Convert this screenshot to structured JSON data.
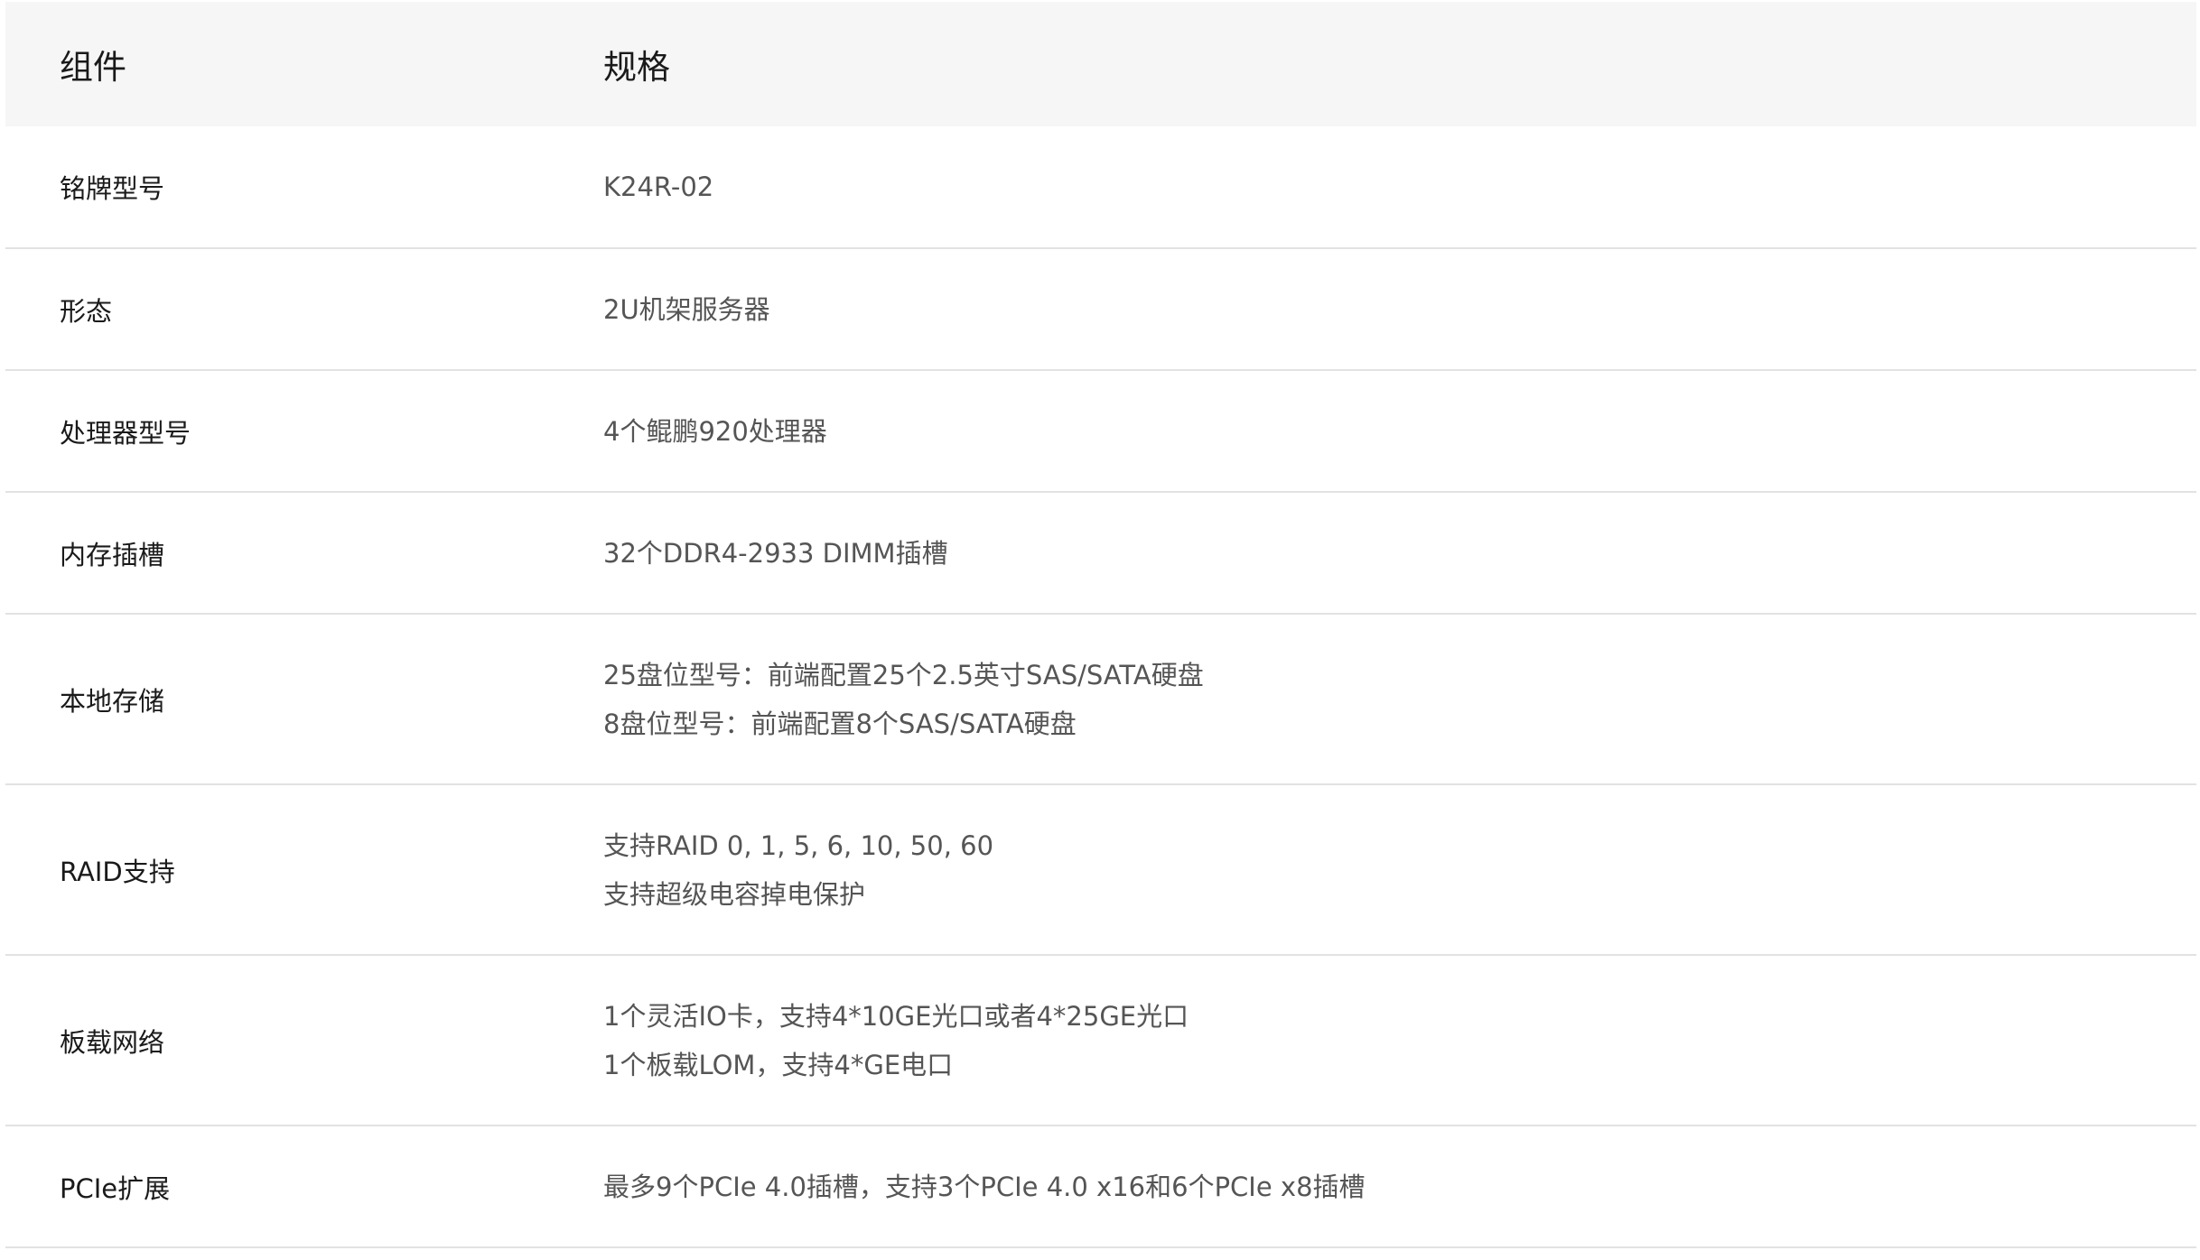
{
  "table": {
    "headers": [
      "组件",
      "规格"
    ],
    "rows": [
      {
        "name": "铭牌型号",
        "values": [
          "K24R-02"
        ]
      },
      {
        "name": "形态",
        "values": [
          "2U机架服务器"
        ]
      },
      {
        "name": "处理器型号",
        "values": [
          "4个鲲鹏920处理器"
        ]
      },
      {
        "name": "内存插槽",
        "values": [
          "32个DDR4-2933 DIMM插槽"
        ]
      },
      {
        "name": "本地存储",
        "values": [
          "25盘位型号：前端配置25个2.5英寸SAS/SATA硬盘",
          "8盘位型号：前端配置8个SAS/SATA硬盘"
        ]
      },
      {
        "name": "RAID支持",
        "values": [
          "支持RAID 0, 1, 5, 6, 10, 50, 60",
          "支持超级电容掉电保护"
        ]
      },
      {
        "name": "板载网络",
        "values": [
          "1个灵活IO卡，支持4*10GE光口或者4*25GE光口",
          "1个板载LOM，支持4*GE电口"
        ]
      },
      {
        "name": "PCIe扩展",
        "values": [
          "最多9个PCIe 4.0插槽，支持3个PCIe 4.0 x16和6个PCIe x8插槽"
        ]
      }
    ]
  }
}
